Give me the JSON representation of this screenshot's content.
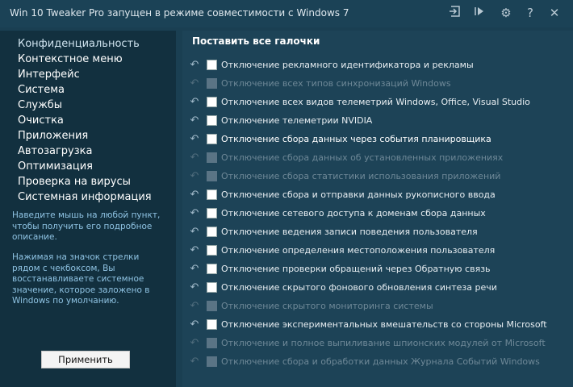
{
  "titlebar": {
    "title": "Win 10 Tweaker Pro запущен в режиме совместимости с Windows 7",
    "icons": [
      "login-icon",
      "play-icon",
      "gear-icon",
      "help-icon",
      "close-icon"
    ]
  },
  "sidebar": {
    "items": [
      "Конфиденциальность",
      "Контекстное меню",
      "Интерфейс",
      "Система",
      "Службы",
      "Очистка",
      "Приложения",
      "Автозагрузка",
      "Оптимизация",
      "Проверка на вирусы",
      "Системная информация"
    ],
    "hint1": "Наведите мышь на любой пункт, чтобы получить его подробное описание.",
    "hint2": "Нажимая на значок стрелки рядом с чекбоксом, Вы восстанавливаете системное значение, которое заложено в Windows по умолчанию.",
    "apply_label": "Применить"
  },
  "main": {
    "check_all": "Поставить все галочки",
    "options": [
      {
        "label": "Отключение рекламного идентификатора и рекламы",
        "enabled": true
      },
      {
        "label": "Отключение всех типов синхронизаций Windows",
        "enabled": false
      },
      {
        "label": "Отключение всех видов телеметрий Windows, Office, Visual Studio",
        "enabled": true
      },
      {
        "label": "Отключение телеметрии NVIDIA",
        "enabled": true
      },
      {
        "label": "Отключение сбора данных через события планировщика",
        "enabled": true
      },
      {
        "label": "Отключение сбора данных об установленных приложениях",
        "enabled": false
      },
      {
        "label": "Отключение сбора статистики использования приложений",
        "enabled": false
      },
      {
        "label": "Отключение сбора и отправки данных рукописного ввода",
        "enabled": true
      },
      {
        "label": "Отключение сетевого доступа к доменам сбора данных",
        "enabled": true
      },
      {
        "label": "Отключение ведения записи поведения пользователя",
        "enabled": true
      },
      {
        "label": "Отключение определения местоположения пользователя",
        "enabled": true
      },
      {
        "label": "Отключение проверки обращений через Обратную связь",
        "enabled": true
      },
      {
        "label": "Отключение скрытого фонового обновления синтеза речи",
        "enabled": true
      },
      {
        "label": "Отключение скрытого мониторинга системы",
        "enabled": false
      },
      {
        "label": "Отключение экспериментальных вмешательств со стороны Microsoft",
        "enabled": true
      },
      {
        "label": "Отключение и полное выпиливание шпионских модулей от Microsoft",
        "enabled": false
      },
      {
        "label": "Отключение сбора и обработки данных Журнала Событий Windows",
        "enabled": false
      }
    ]
  }
}
